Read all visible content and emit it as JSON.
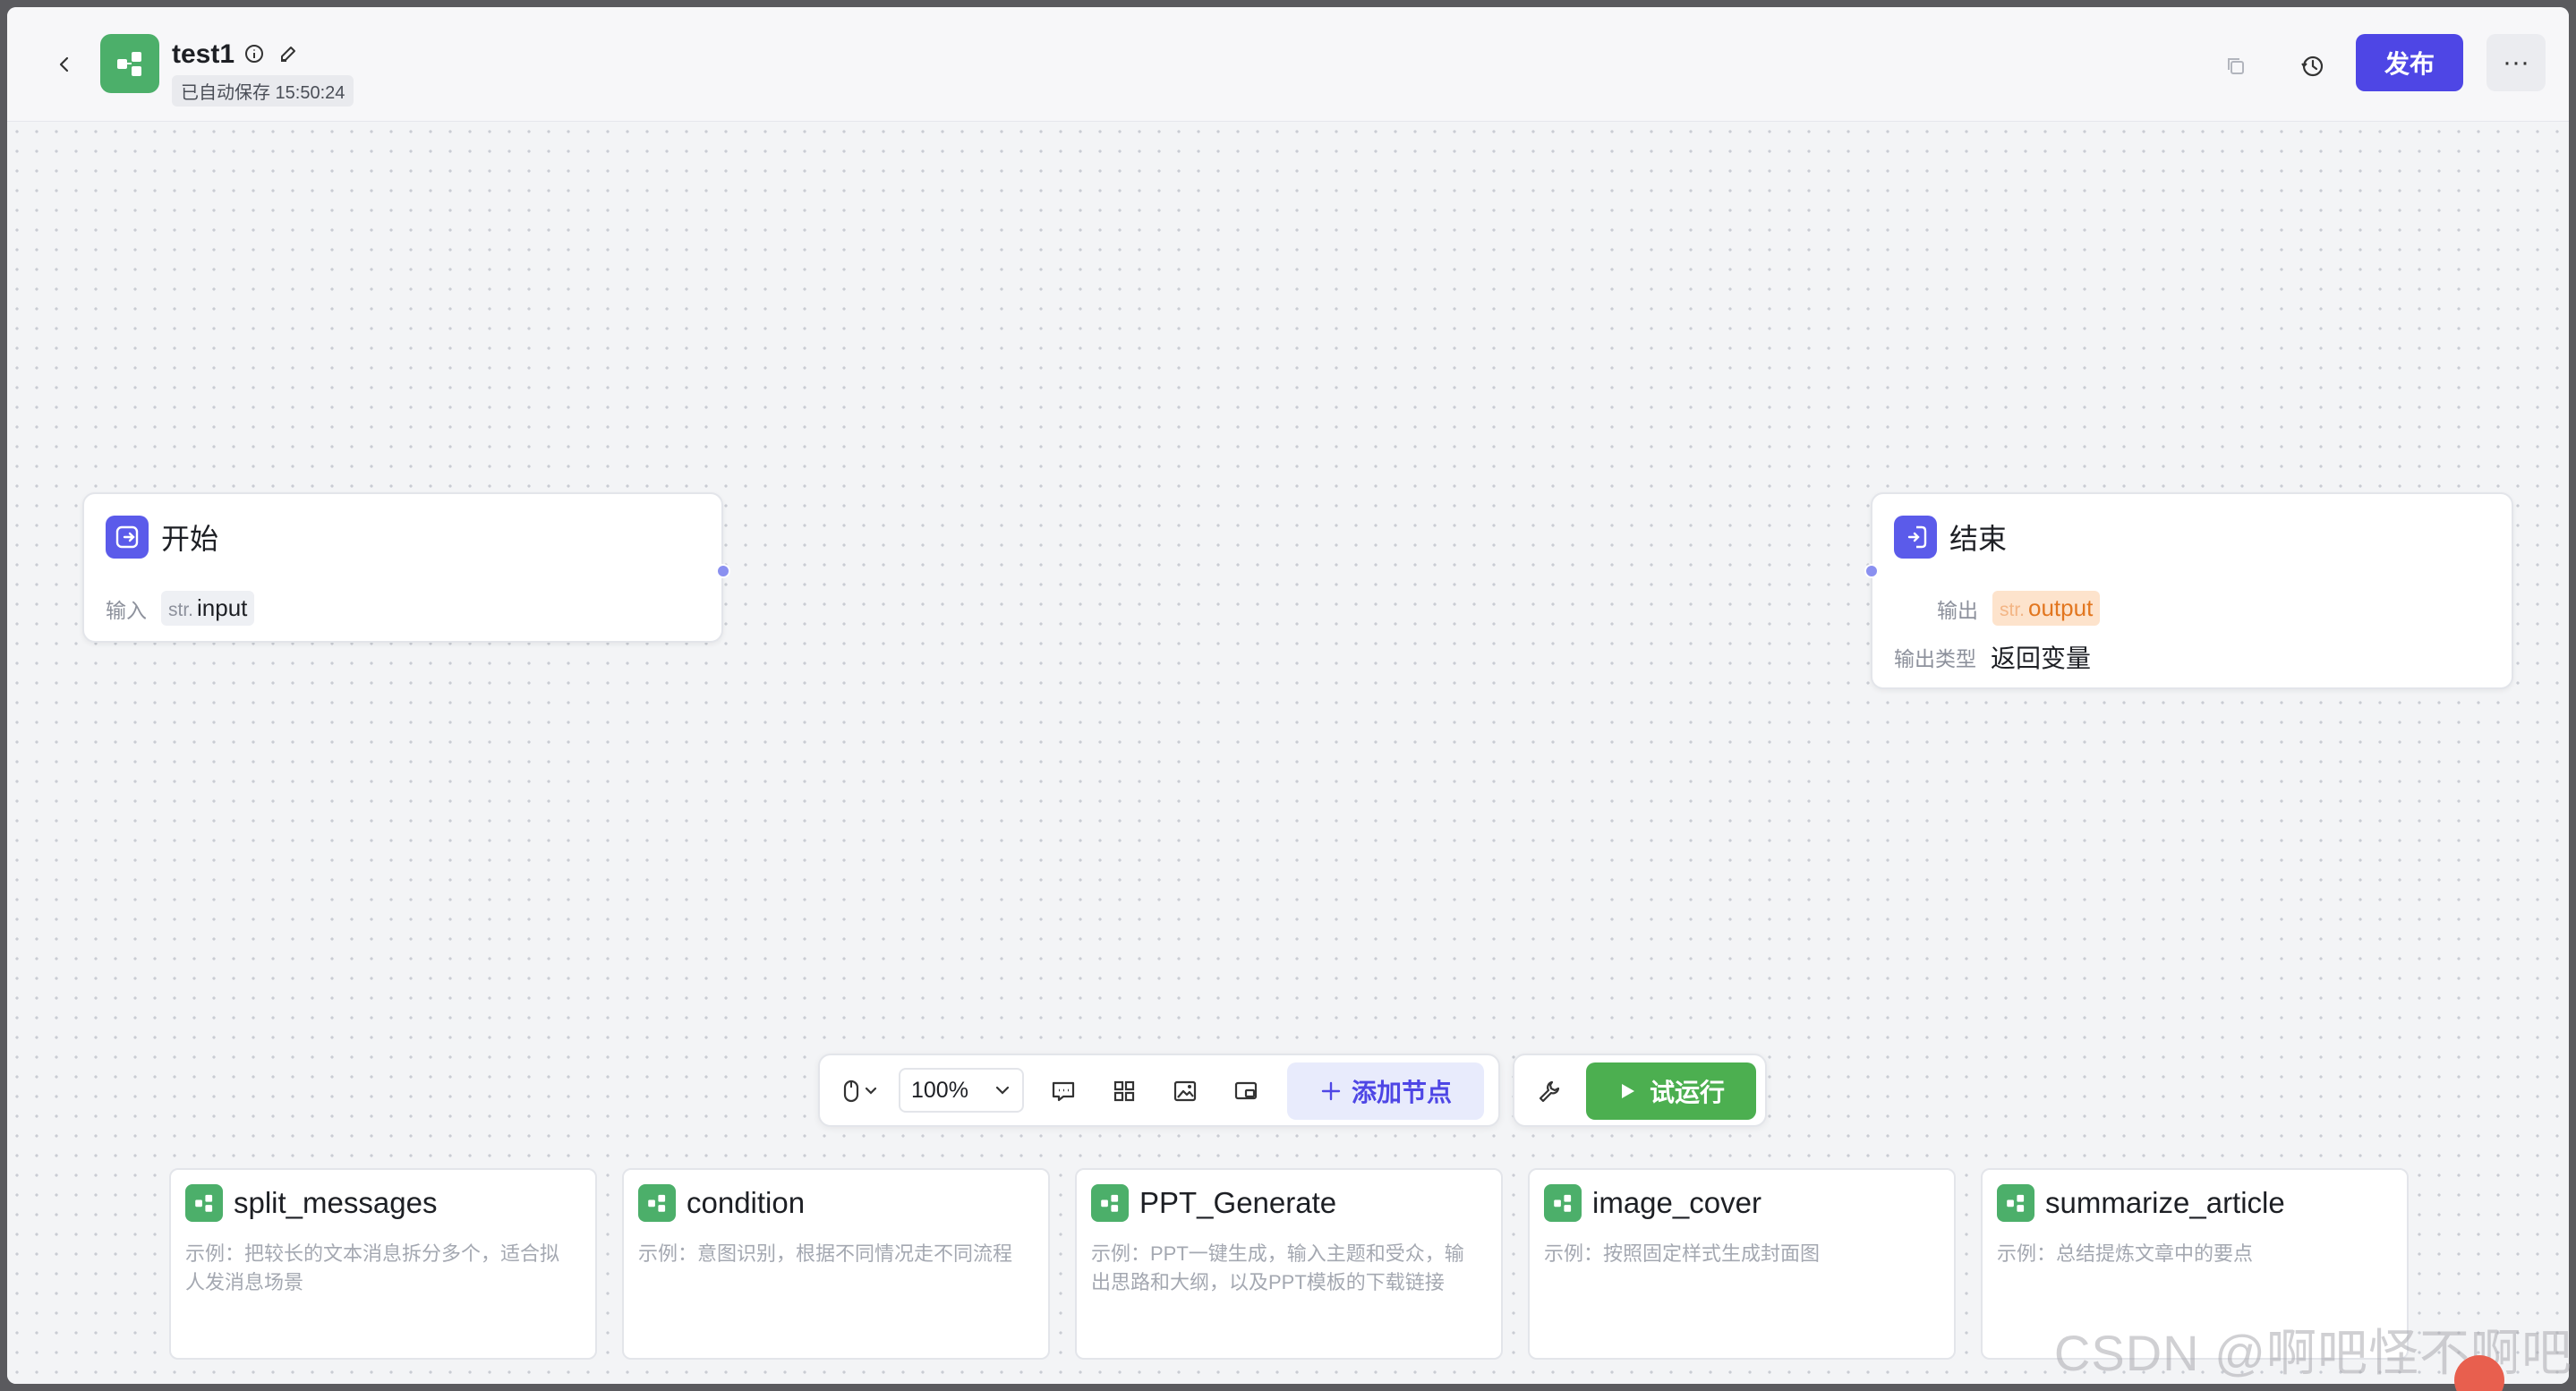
{
  "header": {
    "title": "test1",
    "autosave": "已自动保存 15:50:24",
    "publish_label": "发布",
    "more_label": "···"
  },
  "nodes": {
    "start": {
      "title": "开始",
      "input_label": "输入",
      "input_type": "str.",
      "input_name": "input"
    },
    "end": {
      "title": "结束",
      "output_label": "输出",
      "output_type": "str.",
      "output_name": "output",
      "output_kind_label": "输出类型",
      "output_kind_value": "返回变量"
    }
  },
  "toolbar": {
    "zoom": "100%",
    "add_node_label": "添加节点",
    "run_label": "试运行"
  },
  "templates": [
    {
      "title": "split_messages",
      "desc": "示例：把较长的文本消息拆分多个，适合拟人发消息场景"
    },
    {
      "title": "condition",
      "desc": "示例：意图识别，根据不同情况走不同流程"
    },
    {
      "title": "PPT_Generate",
      "desc": "示例：PPT一键生成，输入主题和受众，输出思路和大纲，以及PPT模板的下载链接"
    },
    {
      "title": "image_cover",
      "desc": "示例：按照固定样式生成封面图"
    },
    {
      "title": "summarize_article",
      "desc": "示例：总结提炼文章中的要点"
    }
  ],
  "watermark": "CSDN @啊吧怪不啊吧",
  "colors": {
    "primary": "#4e46e5",
    "run_green": "#4caf50",
    "workflow_green": "#4caf6a",
    "node_icon": "#5b5bea",
    "output_tag": "#fde3cc"
  }
}
